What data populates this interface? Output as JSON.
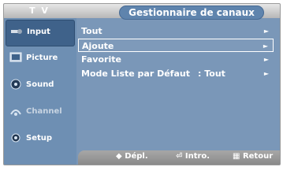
{
  "header": {
    "tv_label": "T V",
    "title": "Gestionnaire de canaux"
  },
  "sidebar": {
    "items": [
      {
        "label": "Input",
        "icon": "input-icon"
      },
      {
        "label": "Picture",
        "icon": "picture-icon"
      },
      {
        "label": "Sound",
        "icon": "sound-icon"
      },
      {
        "label": "Channel",
        "icon": "channel-icon"
      },
      {
        "label": "Setup",
        "icon": "setup-icon"
      }
    ]
  },
  "menu": {
    "items": [
      {
        "label": "Tout",
        "value": ""
      },
      {
        "label": "Ajoute",
        "value": ""
      },
      {
        "label": "Favorite",
        "value": ""
      },
      {
        "label": "Mode Liste par Défaut",
        "value": ": Tout"
      }
    ],
    "arrow": "►"
  },
  "footer": {
    "move_label": "Dépl.",
    "enter_label": "Intro.",
    "return_label": "Retour"
  },
  "colors": {
    "screen": "#7a97b8",
    "header": "#b7b7b7",
    "selected_border": "#ffffff"
  }
}
